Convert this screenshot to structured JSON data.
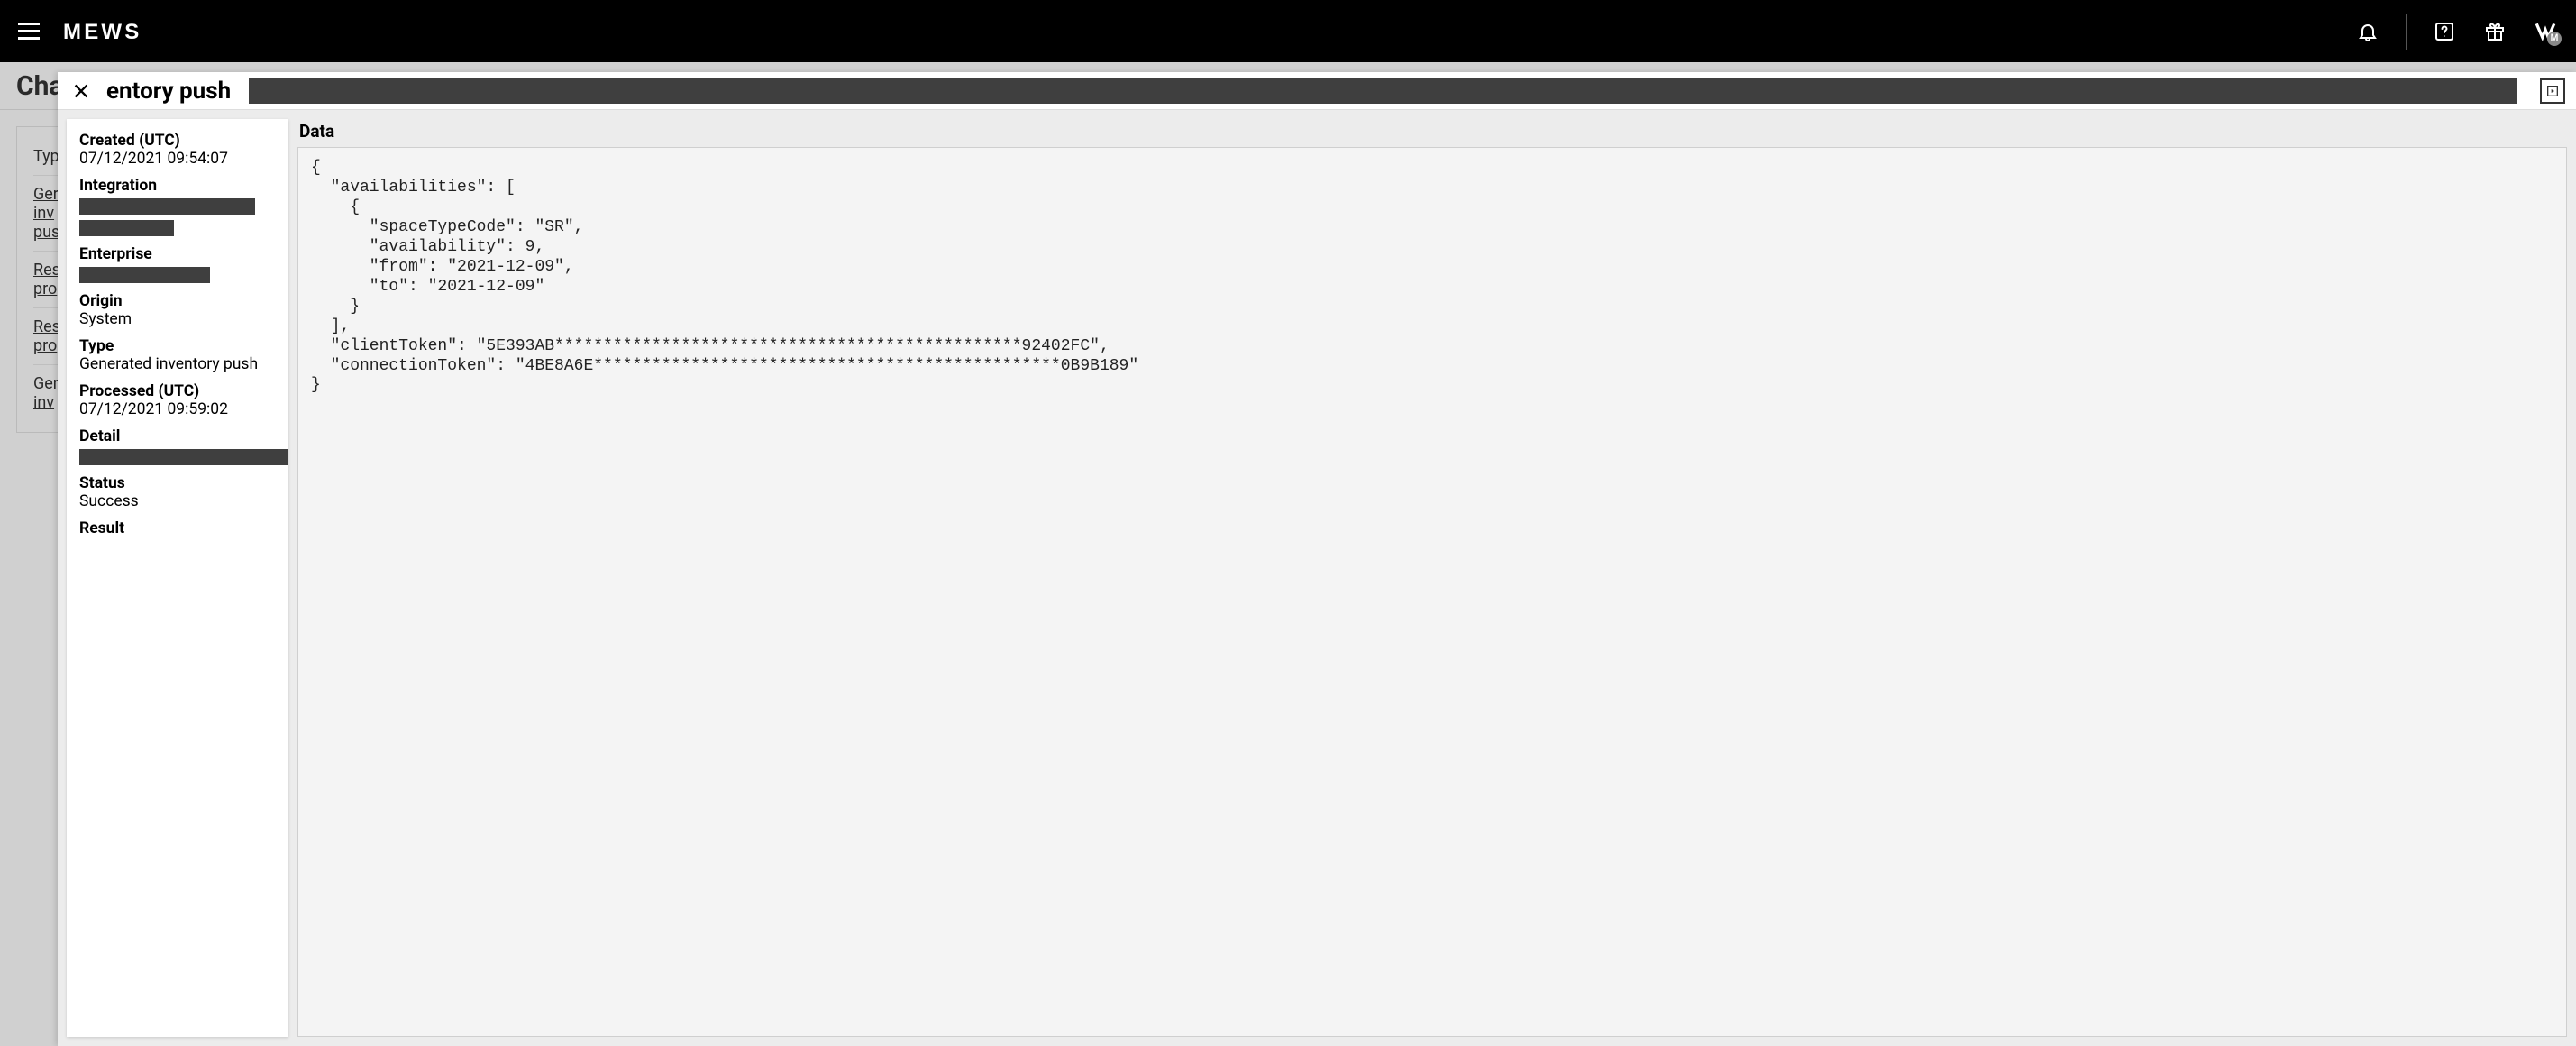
{
  "topbar": {
    "logo_text": "MEWS",
    "avatar_letter": "M",
    "avatar_badge": "M"
  },
  "background_page": {
    "heading_prefix": "Cha",
    "col_header": "Typ",
    "rows": [
      [
        "Ger",
        "inv",
        "pus"
      ],
      [
        "Res",
        "pro"
      ],
      [
        "Res",
        "pro"
      ],
      [
        "Ger",
        "inv"
      ]
    ]
  },
  "panel": {
    "title_visible": "entory push",
    "meta": {
      "created_label": "Created (UTC)",
      "created_value": "07/12/2021 09:54:07",
      "integration_label": "Integration",
      "enterprise_label": "Enterprise",
      "origin_label": "Origin",
      "origin_value": "System",
      "type_label": "Type",
      "type_value": "Generated inventory push",
      "processed_label": "Processed (UTC)",
      "processed_value": "07/12/2021 09:59:02",
      "detail_label": "Detail",
      "status_label": "Status",
      "status_value": "Success",
      "result_label": "Result"
    },
    "data_title": "Data",
    "data_body": "{\n  \"availabilities\": [\n    {\n      \"spaceTypeCode\": \"SR\",\n      \"availability\": 9,\n      \"from\": \"2021-12-09\",\n      \"to\": \"2021-12-09\"\n    }\n  ],\n  \"clientToken\": \"5E393AB************************************************92402FC\",\n  \"connectionToken\": \"4BE8A6E************************************************0B9B189\"\n}"
  }
}
